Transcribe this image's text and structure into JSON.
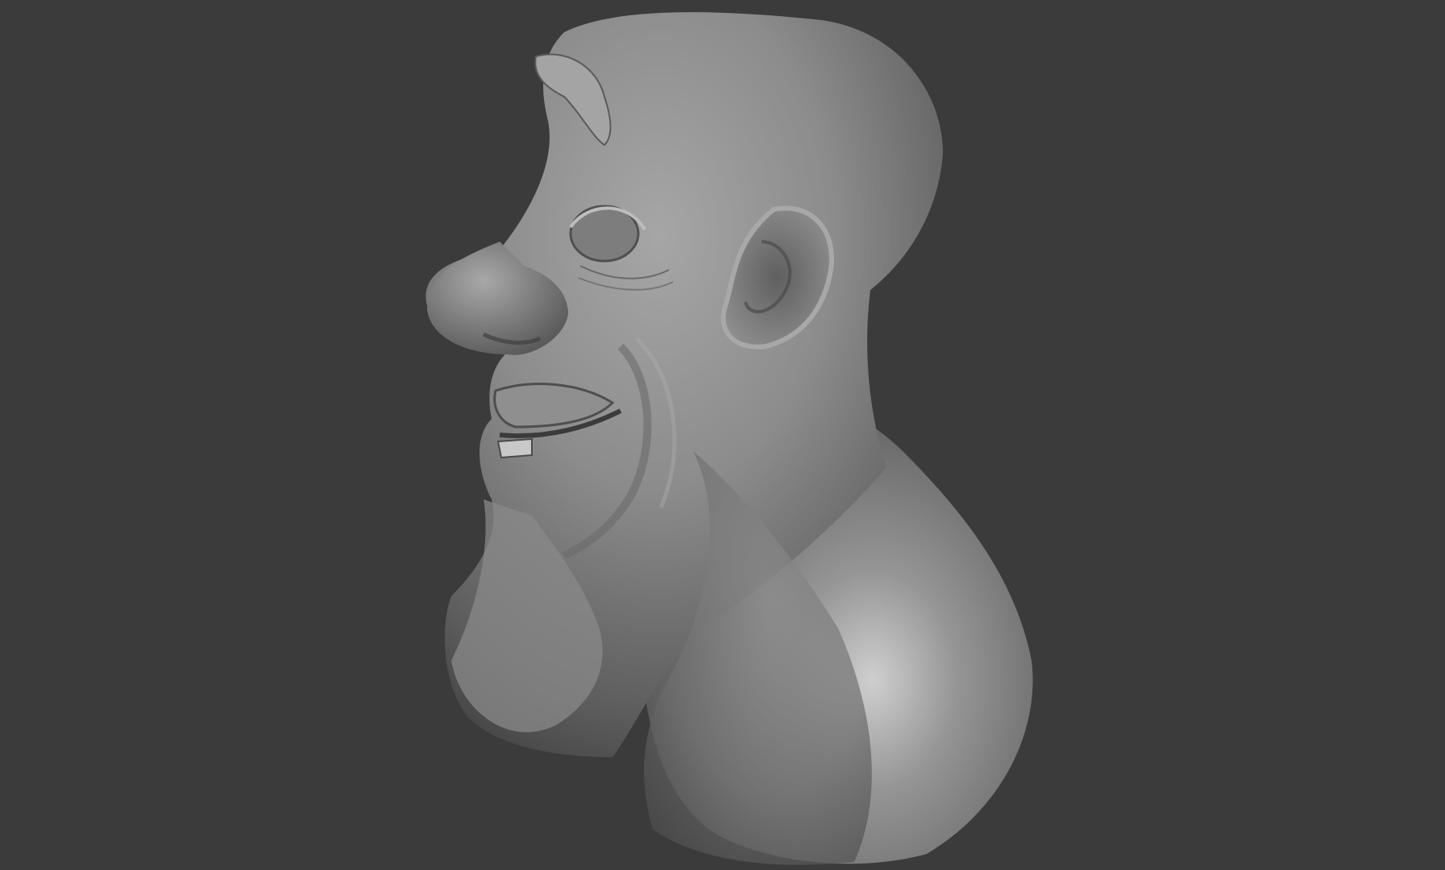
{
  "scene": {
    "background_color": "#3b3b3b",
    "subject": "sculpted-head-bust",
    "material_color": "#8a8a8a",
    "view": "profile-left"
  }
}
